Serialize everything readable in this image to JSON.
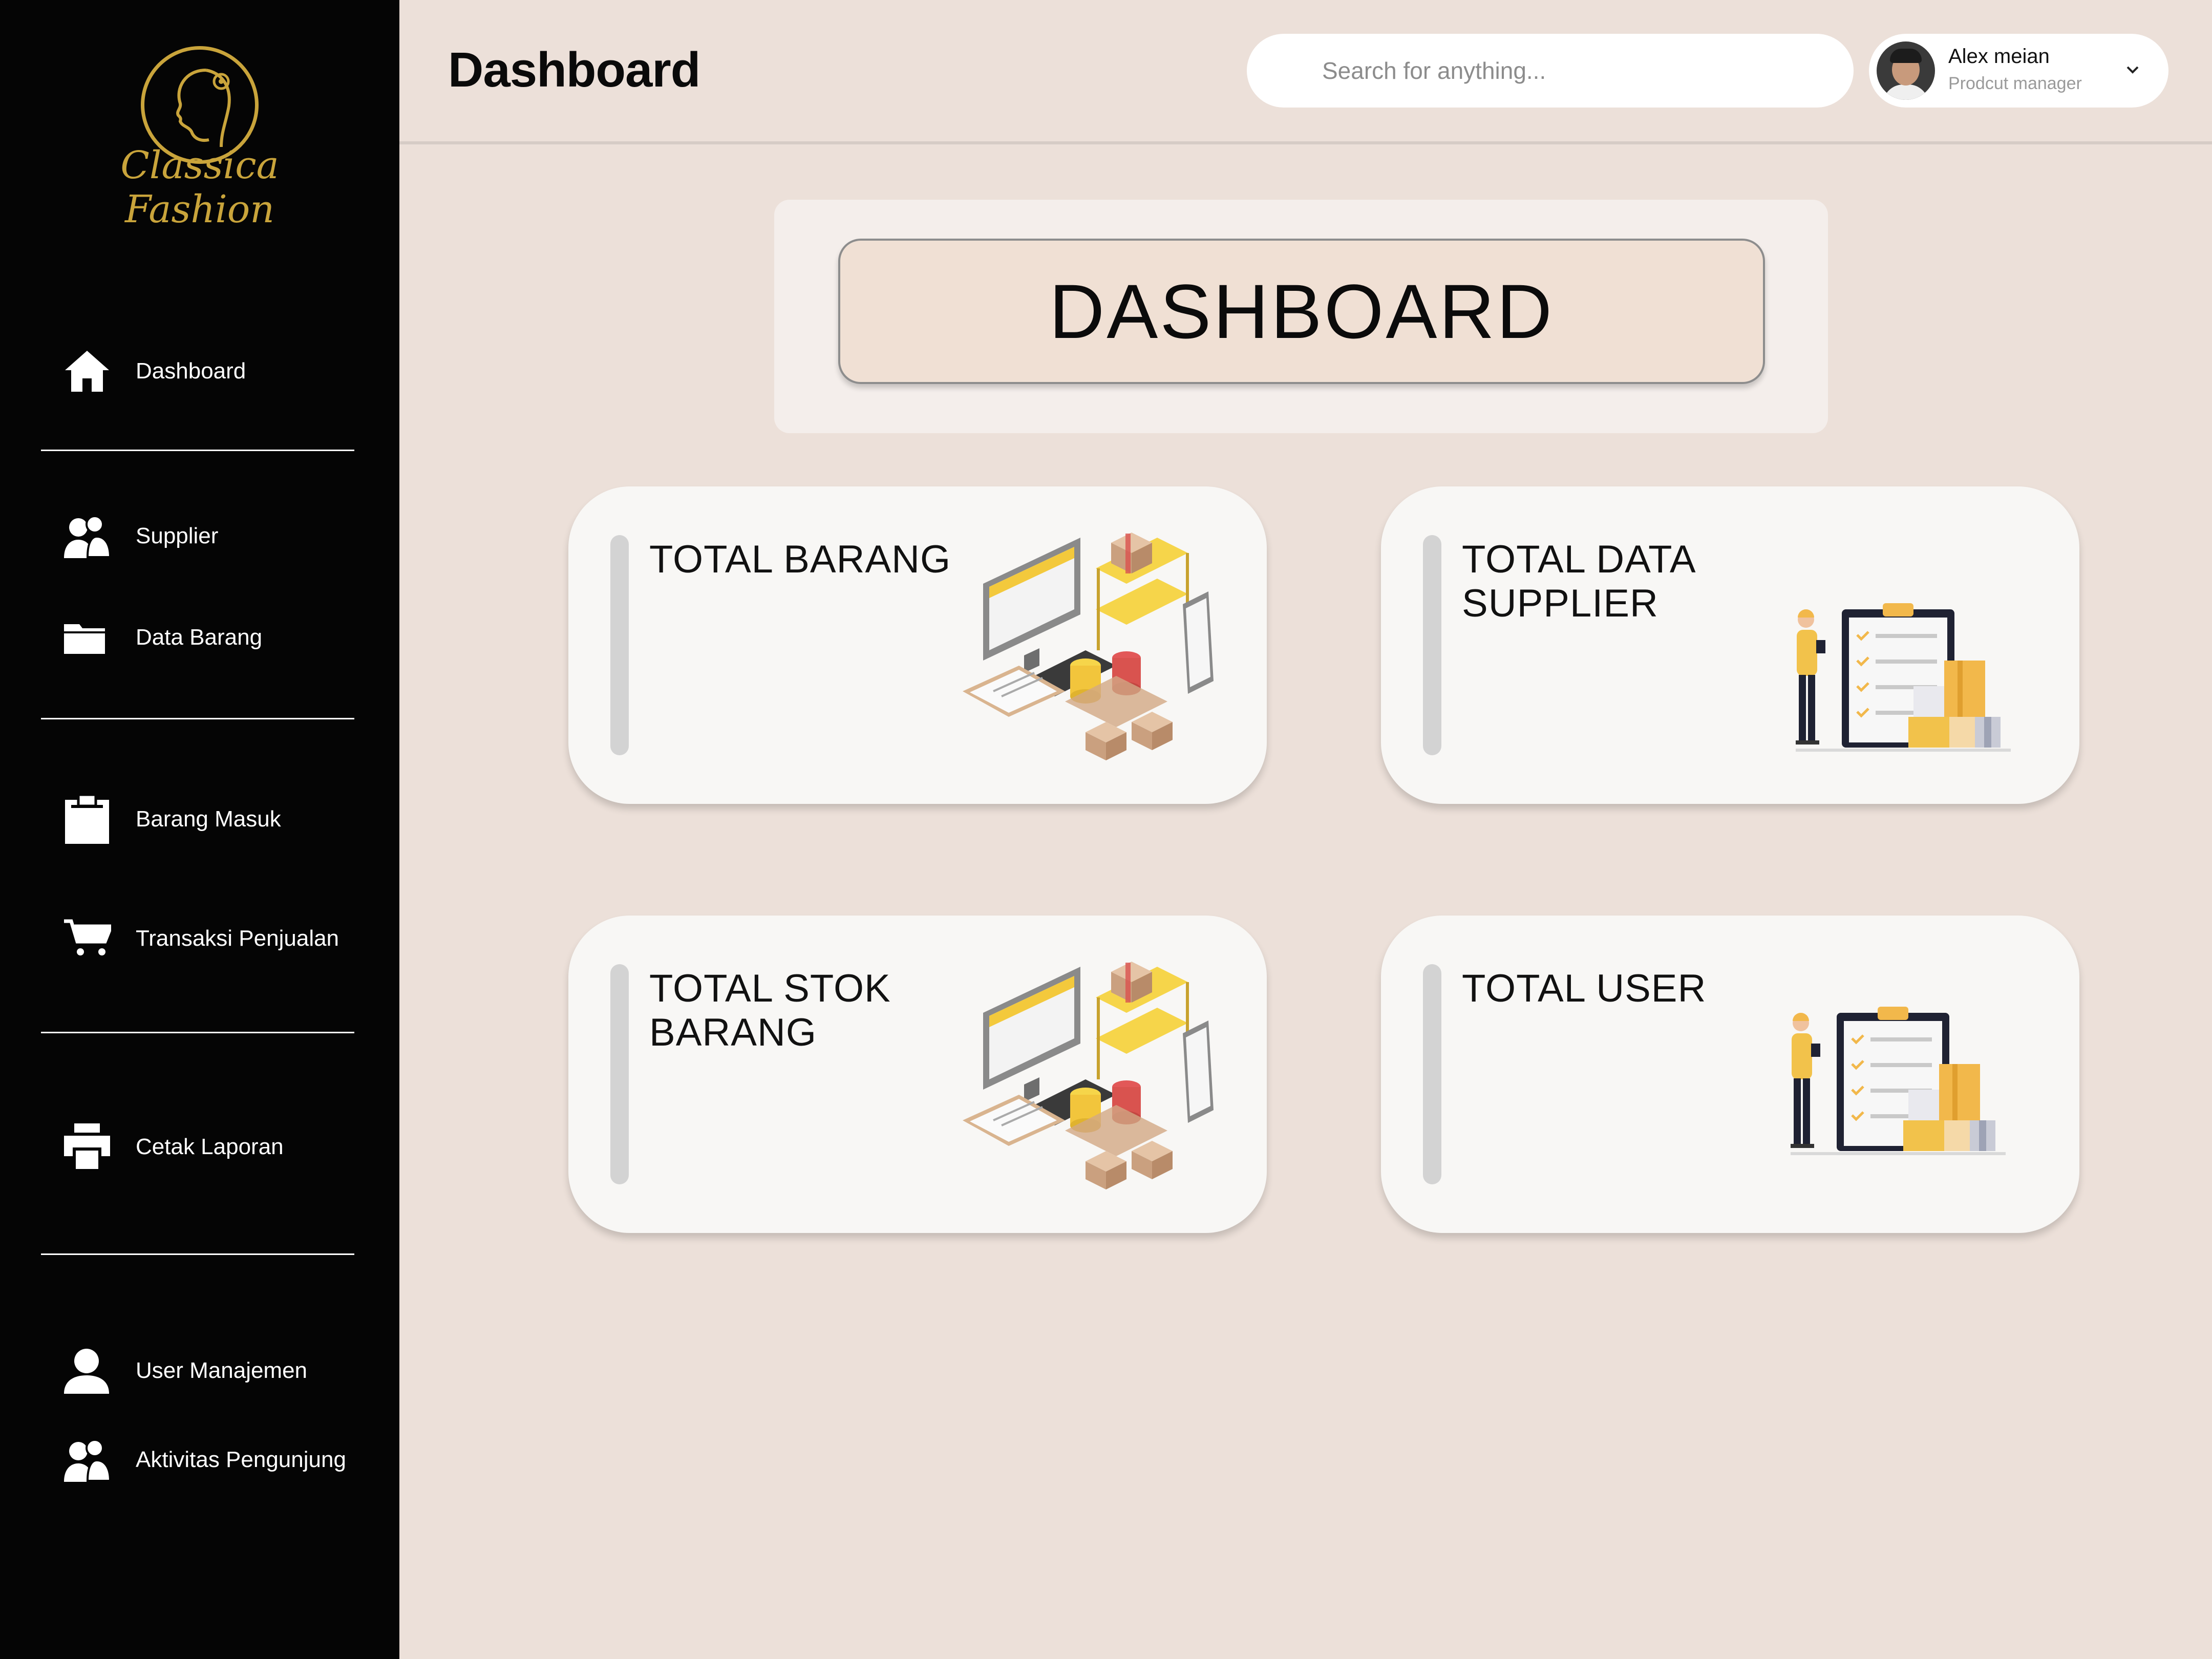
{
  "app": {
    "brand": "Classica Fashion",
    "page_title": "Dashboard"
  },
  "sidebar": {
    "items": [
      {
        "label": "Dashboard",
        "icon": "home-icon"
      },
      {
        "label": "Supplier",
        "icon": "users-icon"
      },
      {
        "label": "Data Barang",
        "icon": "folder-icon"
      },
      {
        "label": "Barang Masuk",
        "icon": "clipboard-icon"
      },
      {
        "label": "Transaksi Penjualan",
        "icon": "cart-icon"
      },
      {
        "label": "Cetak Laporan",
        "icon": "printer-icon"
      },
      {
        "label": "User Manajemen",
        "icon": "user-icon"
      },
      {
        "label": "Aktivitas Pengunjung",
        "icon": "users-icon"
      }
    ]
  },
  "header": {
    "search_placeholder": "Search for anything...",
    "user_name": "Alex meian",
    "user_role": "Prodcut manager"
  },
  "main": {
    "banner_title": "DASHBOARD",
    "cards": [
      {
        "title_line1": "TOTAL BARANG",
        "title_line2": "",
        "illustration": "warehouse-illustration"
      },
      {
        "title_line1": "TOTAL DATA",
        "title_line2": "SUPPLIER",
        "illustration": "checklist-illustration"
      },
      {
        "title_line1": "TOTAL STOK",
        "title_line2": "BARANG",
        "illustration": "warehouse-illustration"
      },
      {
        "title_line1": "TOTAL USER",
        "title_line2": "",
        "illustration": "checklist-illustration"
      }
    ]
  },
  "colors": {
    "sidebar_bg": "#050505",
    "page_bg": "#ece0d9",
    "brand_gold": "#c9a43b",
    "card_bg": "#f8f7f5",
    "banner_bg": "#f0e0d4"
  }
}
